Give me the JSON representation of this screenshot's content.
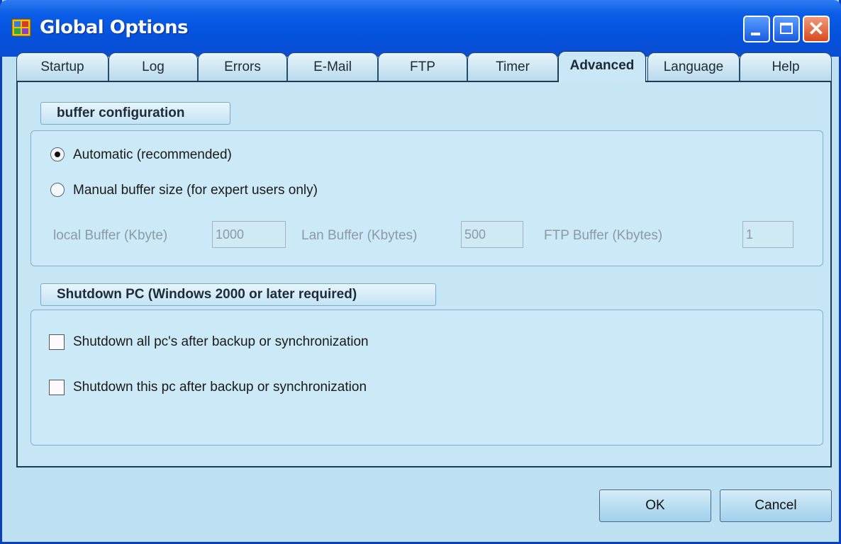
{
  "window": {
    "title": "Global Options"
  },
  "tabs": [
    {
      "label": "Startup"
    },
    {
      "label": "Log"
    },
    {
      "label": "Errors"
    },
    {
      "label": "E-Mail"
    },
    {
      "label": "FTP"
    },
    {
      "label": "Timer"
    },
    {
      "label": "Advanced",
      "active": true
    },
    {
      "label": "Language"
    },
    {
      "label": "Help"
    }
  ],
  "buffer": {
    "title": "buffer configuration",
    "auto_label": "Automatic (recommended)",
    "manual_label": "Manual buffer size (for expert users only)",
    "selected": "automatic",
    "local_label": "local Buffer (Kbyte)",
    "local_value": "1000",
    "lan_label": "Lan Buffer (Kbytes)",
    "lan_value": "500",
    "ftp_label": "FTP Buffer (Kbytes)",
    "ftp_value": "1"
  },
  "shutdown": {
    "title": "Shutdown PC (Windows 2000 or later required)",
    "all_label": "Shutdown all pc's after backup or synchronization",
    "all_checked": false,
    "this_label": "Shutdown this pc after backup or synchronization",
    "this_checked": false
  },
  "buttons": {
    "ok": "OK",
    "cancel": "Cancel"
  }
}
